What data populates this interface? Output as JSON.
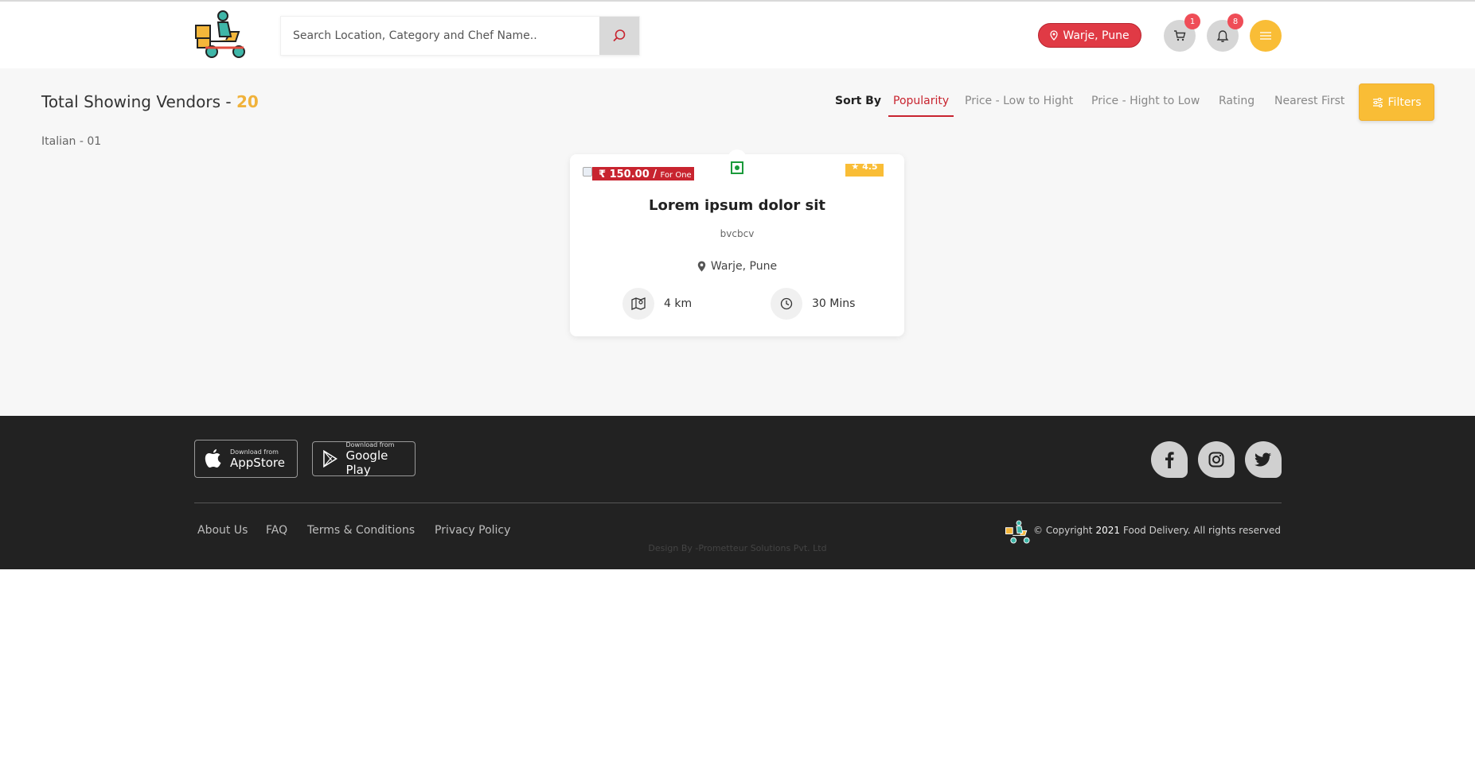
{
  "header": {
    "search_placeholder": "Search Location, Category and Chef Name..",
    "location_label": "Warje, Pune",
    "cart_count": "1",
    "notification_count": "8"
  },
  "main": {
    "title_prefix": "Total Showing Vendors - ",
    "vendor_count": "20",
    "subcategory": "Italian - 01",
    "sort_label": "Sort By",
    "sort_options": [
      "Popularity",
      "Price - Low to Hight",
      "Price - Hight to Low",
      "Rating",
      "Nearest First"
    ],
    "active_sort": "Popularity",
    "filters_label": "Filters"
  },
  "card": {
    "price": "₹ 150.00 / ",
    "price_unit": "For One",
    "rating": "★ 4.5",
    "title": "Lorem ipsum dolor sit",
    "subtitle": "bvcbcv",
    "location": "Warje, Pune",
    "distance": "4 km",
    "time": "30 Mins"
  },
  "footer": {
    "appstore_small": "Download from",
    "appstore_big": "AppStore",
    "playstore_small": "Download from",
    "playstore_big": "Google Play",
    "links": [
      "About Us",
      "FAQ",
      "Terms & Conditions",
      "Privacy Policy"
    ],
    "design_by": "Design By -Prometteur Solutions Pvt. Ltd",
    "copyright_prefix": "© Copyright",
    "copyright_year": "2021",
    "copyright_suffix": "Food Delivery. All rights reserved"
  },
  "colors": {
    "accent_red": "#c8242f",
    "accent_yellow": "#f9bd36",
    "footer_bg": "#222222",
    "veg_green": "#1a9a3a"
  },
  "icons": {
    "logo": "delivery-scooter-logo",
    "search": "search-icon",
    "location": "map-pin-icon",
    "cart": "cart-icon",
    "bell": "bell-icon",
    "menu": "hamburger-menu-icon",
    "filters": "sliders-icon",
    "distance": "map-icon",
    "time": "clock-icon",
    "apple": "apple-icon",
    "play": "google-play-icon",
    "facebook": "facebook-icon",
    "instagram": "instagram-icon",
    "twitter": "twitter-icon"
  }
}
